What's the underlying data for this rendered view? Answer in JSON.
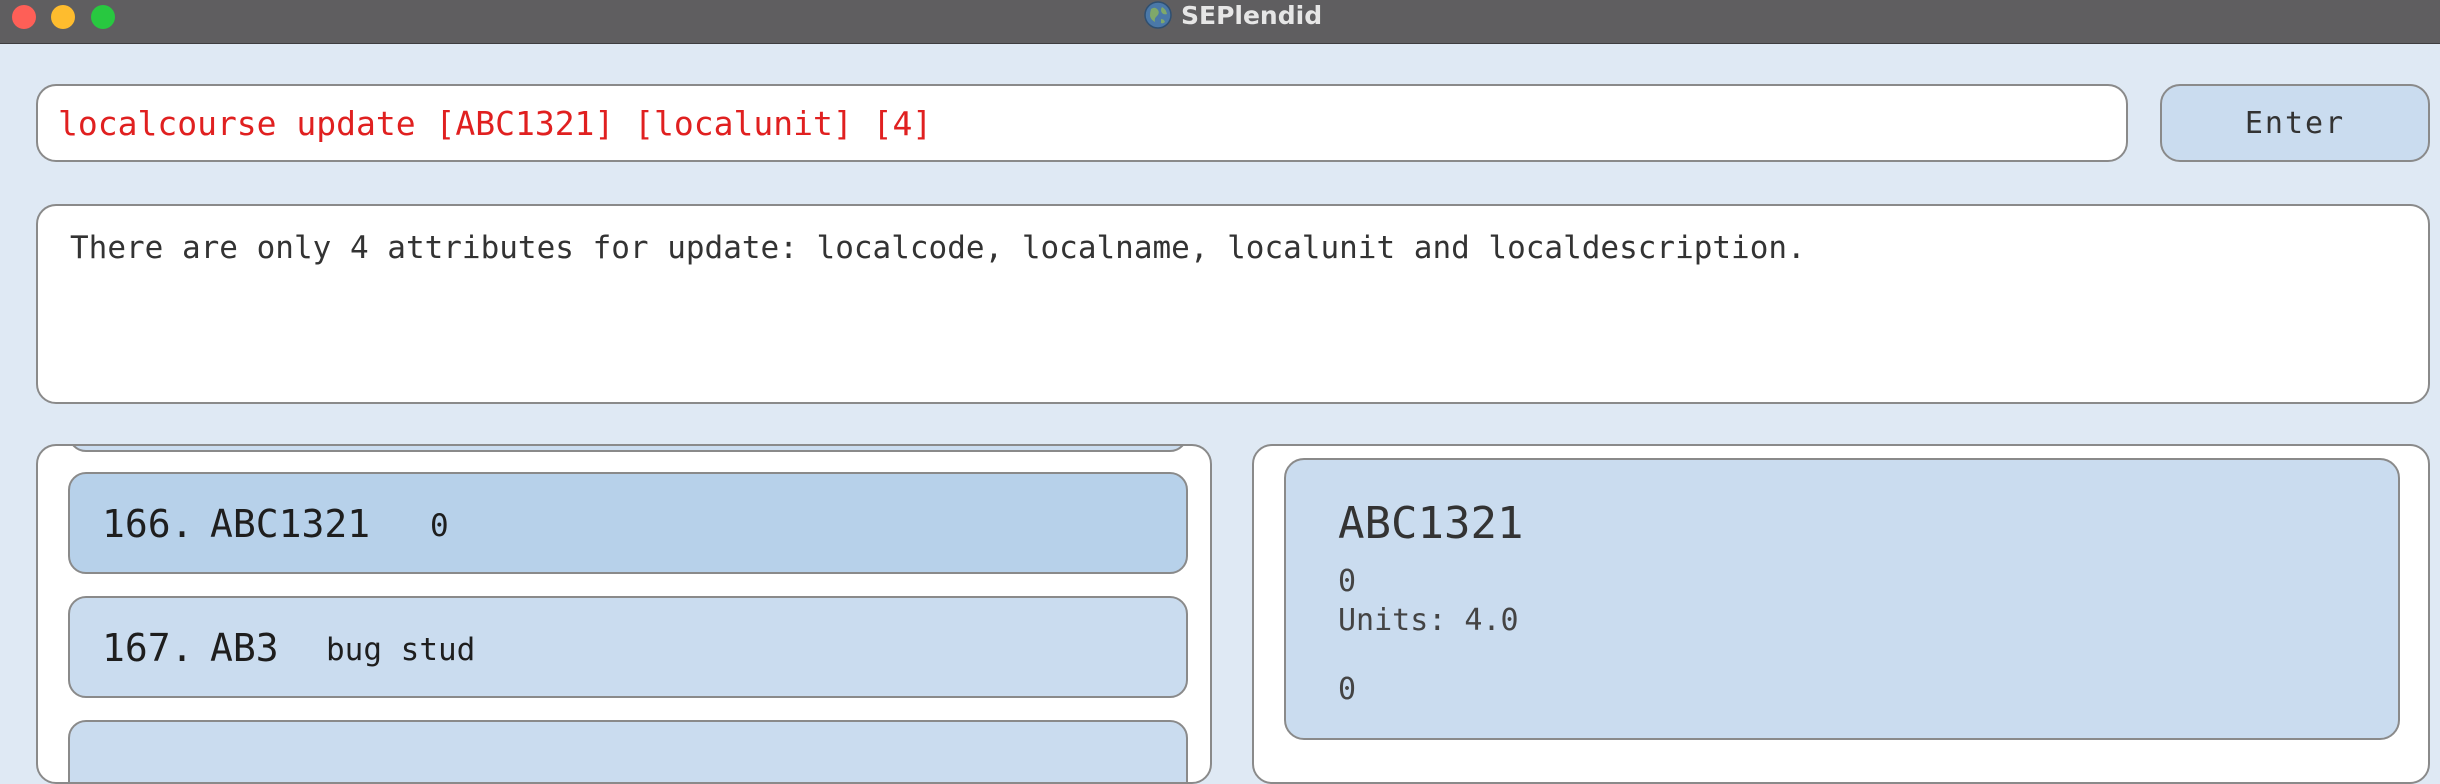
{
  "window": {
    "title": "SEPlendid",
    "icon": "globe-icon"
  },
  "command": {
    "value": "localcourse update [ABC1321] [localunit] [4]",
    "text_color": "#e02020",
    "enter_label": "Enter"
  },
  "result": {
    "text": "There are only 4 attributes for update: localcode, localname, localunit and localdescription."
  },
  "course_list": {
    "items": [
      {
        "index": "166.",
        "code": "ABC1321",
        "description": "0",
        "selected": true
      },
      {
        "index": "167.",
        "code": "AB3",
        "description": "bug stud",
        "selected": false
      }
    ]
  },
  "detail": {
    "code": "ABC1321",
    "name": "0",
    "units": "Units: 4.0",
    "description": "0"
  },
  "colors": {
    "titlebar": "#5f5e60",
    "background": "#dfe9f4",
    "card": "#cadcef",
    "card_selected": "#b7d1ea",
    "error_text": "#e02020"
  }
}
